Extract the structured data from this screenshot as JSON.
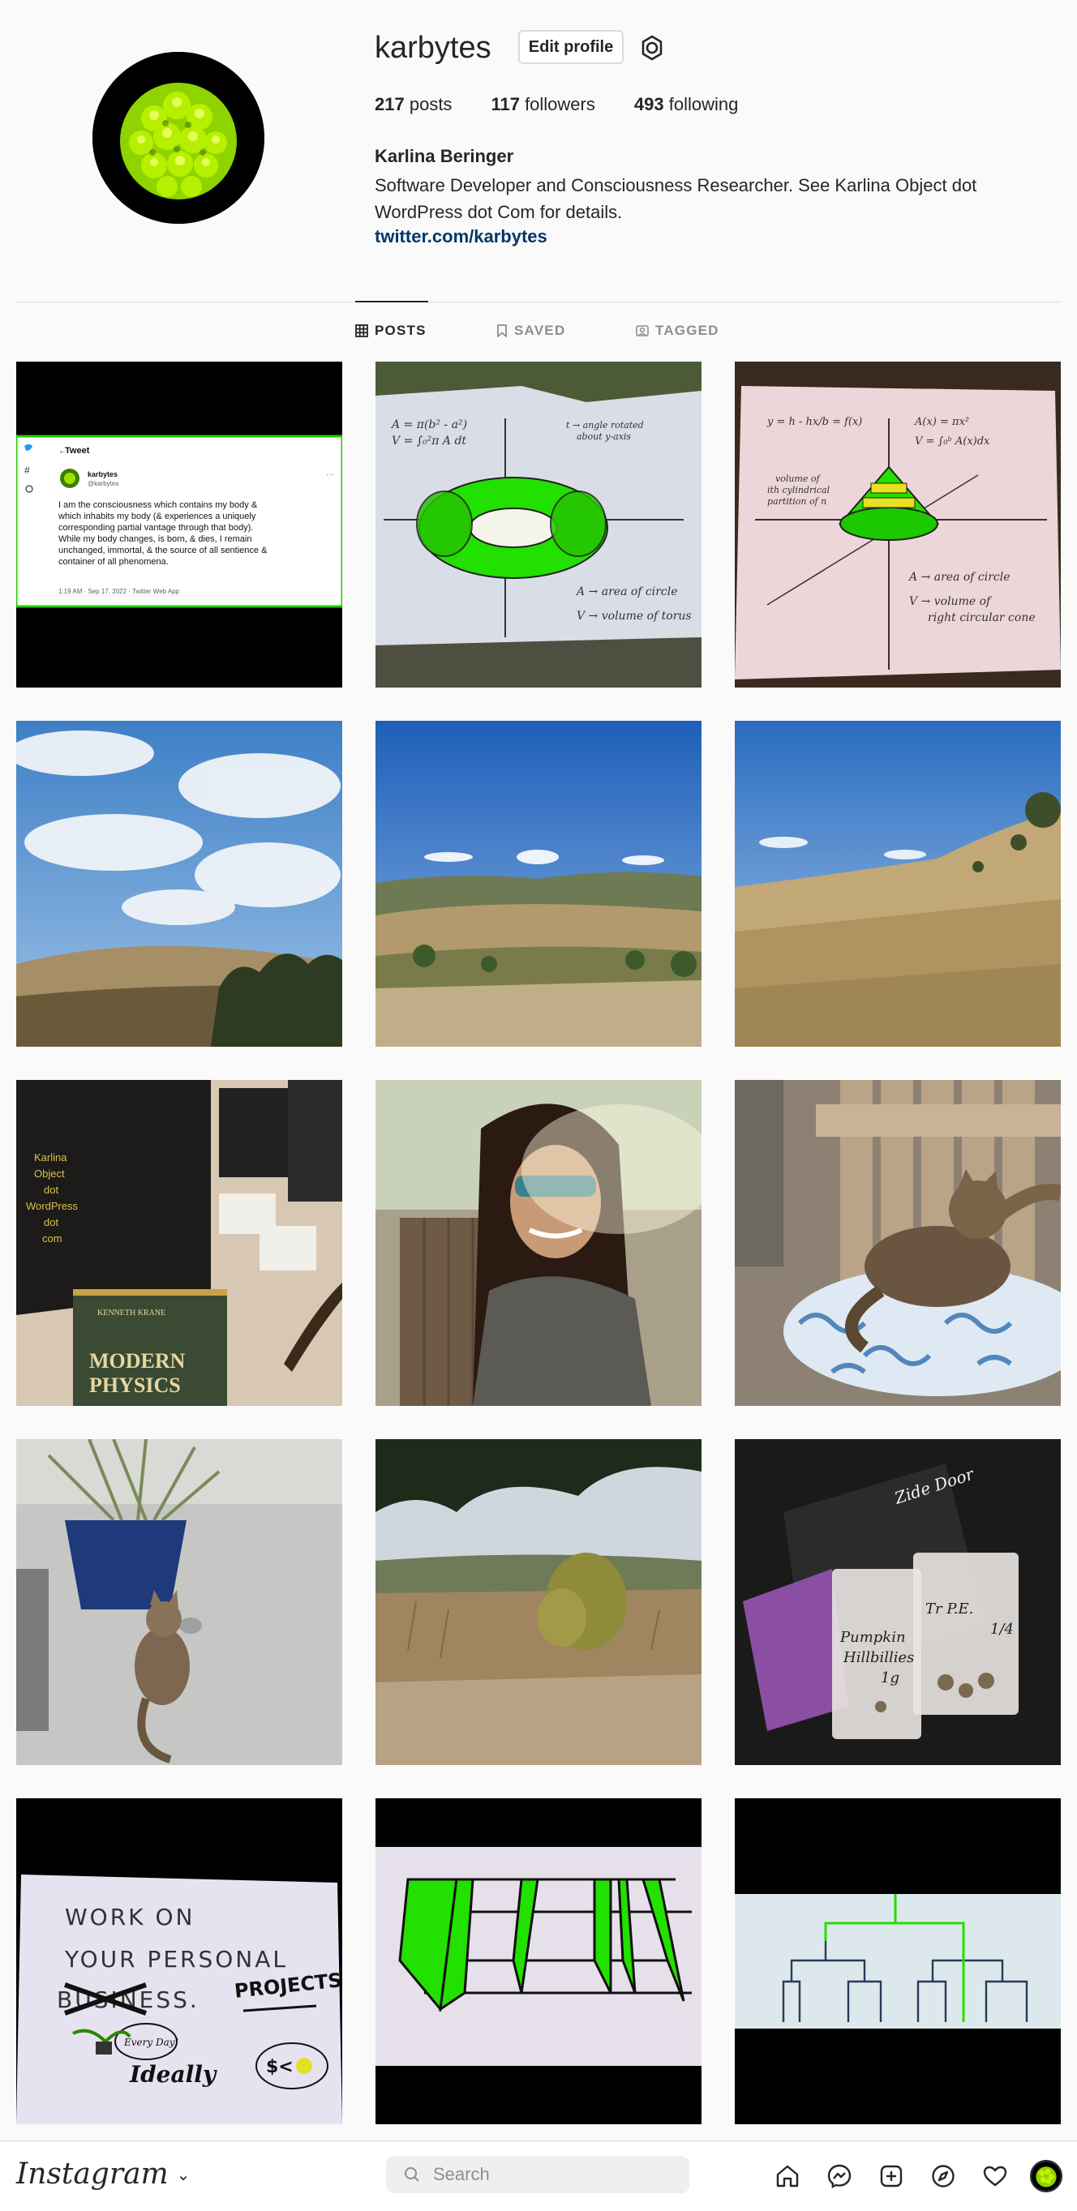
{
  "profile": {
    "username": "karbytes",
    "edit_label": "Edit profile",
    "stats": {
      "posts_count": "217",
      "posts_label": "posts",
      "followers_count": "117",
      "followers_label": "followers",
      "following_count": "493",
      "following_label": "following"
    },
    "full_name": "Karlina Beringer",
    "bio": "Software Developer and Consciousness Researcher. See Karlina Object dot WordPress dot Com for details.",
    "link": "twitter.com/karbytes"
  },
  "tabs": [
    {
      "label": "POSTS",
      "icon": "grid-icon",
      "active": true
    },
    {
      "label": "SAVED",
      "icon": "bookmark-icon",
      "active": false
    },
    {
      "label": "TAGGED",
      "icon": "tag-person-icon",
      "active": false
    }
  ],
  "posts": {
    "tweet": {
      "header": "Tweet",
      "name": "karbytes",
      "handle": "@karbytes",
      "text_lines": [
        "I am the consciousness which contains my body &",
        "which inhabits my body (& experiences a uniquely",
        "corresponding partial vantage through that body).",
        "While my body changes, is born, & dies, I remain",
        "unchanged, immortal, & the source of all sentience &",
        "container of all phenomena."
      ],
      "timestamp": "1:19 AM · Sep 17, 2022 · Twitter Web App"
    },
    "torus_note": {
      "formulas": [
        "A = π(b² - a²)",
        "V = ∫₀²π A dt"
      ],
      "angle_note": [
        "t → angle rotated",
        "about y-axis"
      ],
      "legend": [
        "A → area of circle",
        "V → volume of torus"
      ]
    },
    "cone_note": {
      "formulas": [
        "y = h - hx/b = f(x)",
        "A(x) = πx²",
        "V = ∫₀ᵇ A(x)dx"
      ],
      "sum_note": [
        "volume of",
        "ith cylindrical",
        "partition of n"
      ],
      "legend": [
        "A → area of circle",
        "V → volume of",
        "right circular cone"
      ]
    },
    "shirt_text": [
      "Karlina",
      "Object",
      "dot",
      "WordPress",
      "dot",
      "com"
    ],
    "book_author": "KENNETH KRANE",
    "book_title": [
      "MODERN",
      "PHYSICS"
    ],
    "packet_labels": [
      "Pumpkin",
      "Hillbillies",
      "1g",
      "Tr P.E.",
      "1/4"
    ],
    "zide_door": "Zide Door",
    "sign": {
      "lines": [
        "WORK ON",
        "YOUR PERSONAL",
        "BUSINESS."
      ],
      "replacement": "PROJECTS",
      "bubble": "Every Day!",
      "footer": "Ideally"
    }
  },
  "bottom_nav": {
    "brand": "Instagram",
    "search_placeholder": "Search",
    "icons": [
      "home-icon",
      "messenger-icon",
      "new-post-icon",
      "explore-icon",
      "activity-heart-icon",
      "profile-avatar"
    ]
  },
  "colors": {
    "link": "#00376b",
    "text": "#262626",
    "muted": "#8e8e8e",
    "border": "#dbdbdb",
    "neon_green": "#22e000",
    "tweet_blue": "#1d9bf0"
  }
}
